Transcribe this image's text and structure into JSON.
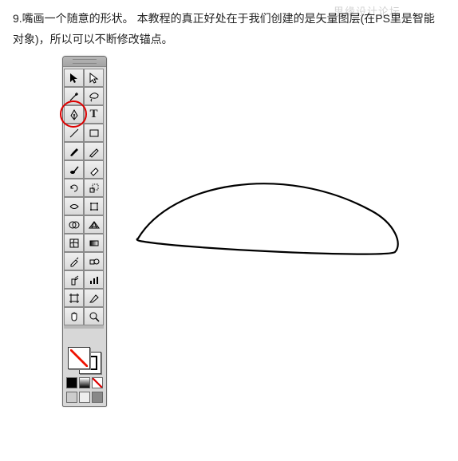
{
  "watermark": "思缘设计论坛",
  "paragraph": "9.嘴画一个随意的形状。 本教程的真正好处在于我们创建的是矢量图层(在PS里是智能对象)，所以可以不断修改锚点。",
  "icons": {
    "type_tool": "T"
  }
}
